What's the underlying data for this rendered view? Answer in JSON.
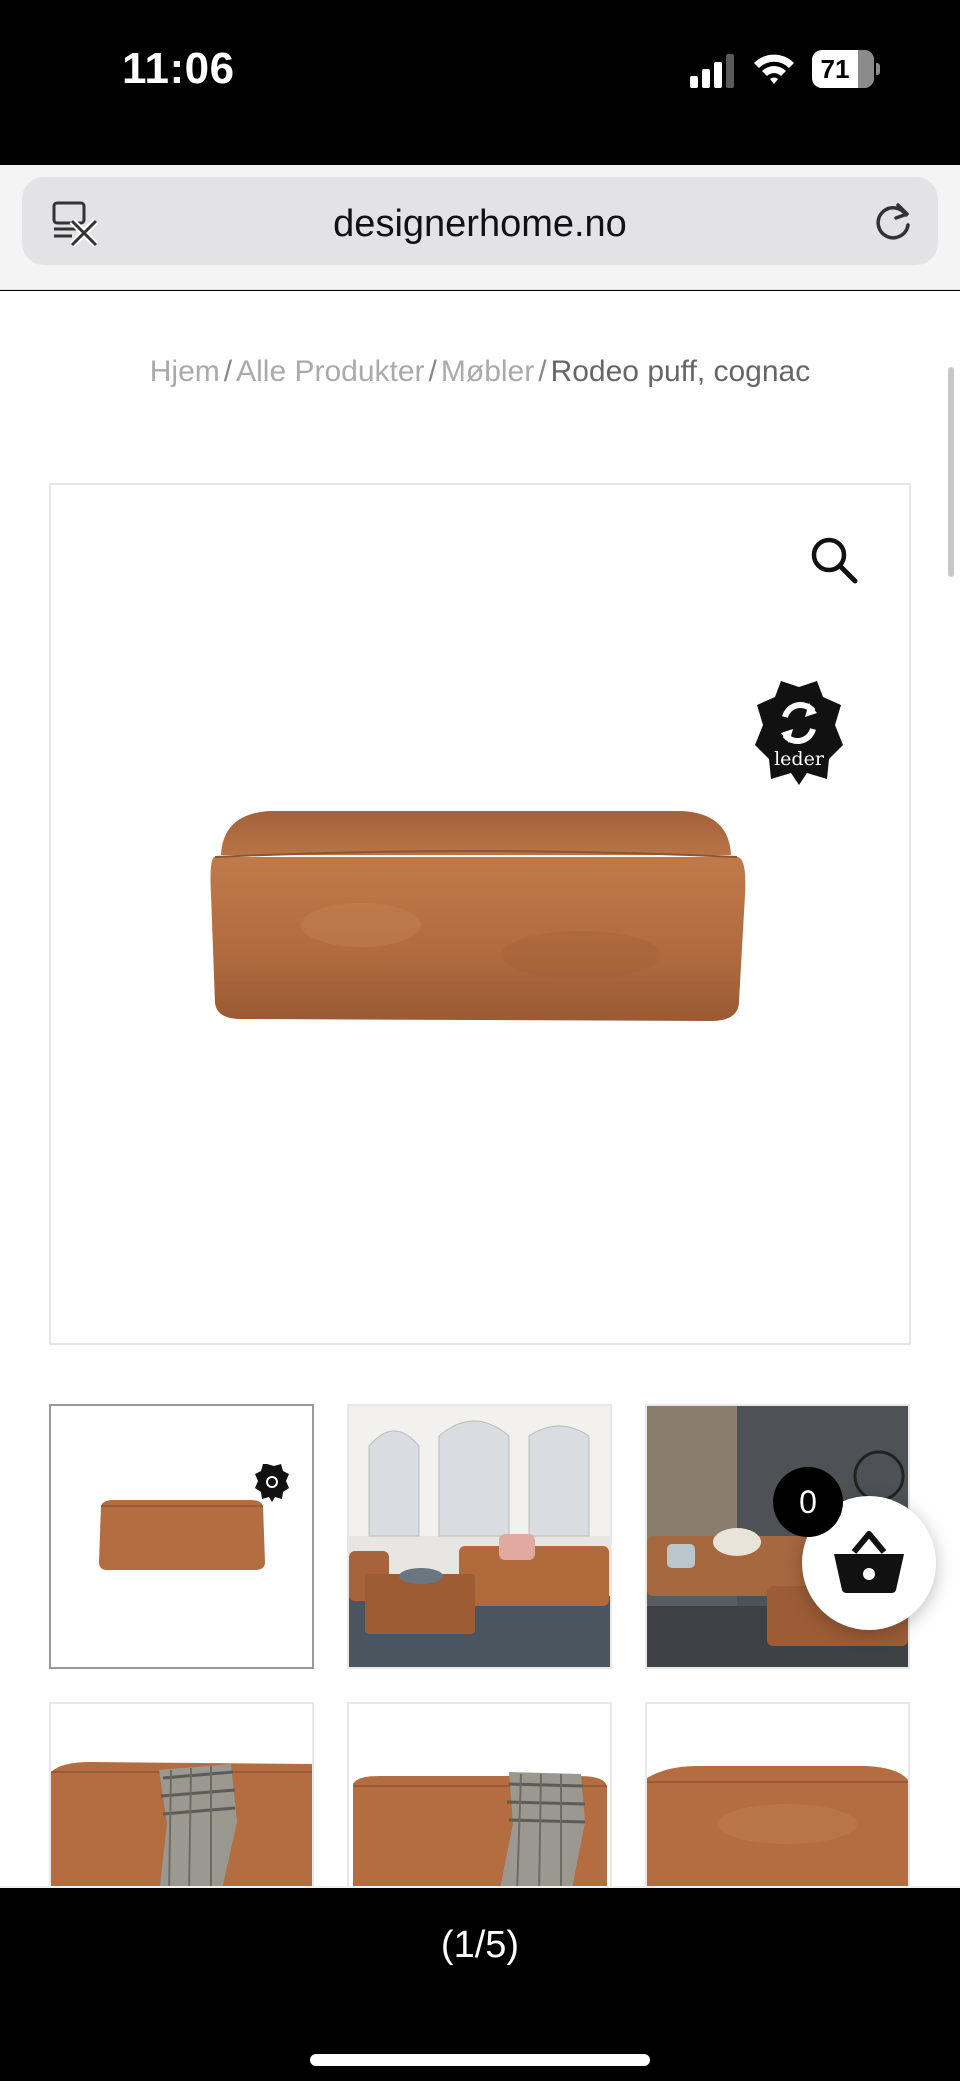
{
  "status": {
    "time": "11:06",
    "battery_level": "71"
  },
  "browser": {
    "url": "designerhome.no"
  },
  "breadcrumb": {
    "home": "Hjem",
    "all_products": "Alle Produkter",
    "furniture": "Møbler",
    "current": "Rodeo puff, cognac",
    "separator": "/"
  },
  "product_image": {
    "badge_text": "leder"
  },
  "thumbnails": [
    {
      "label": "pouf-white-background"
    },
    {
      "label": "living-room-scene-windows"
    },
    {
      "label": "living-room-scene-dark-wall"
    },
    {
      "label": "pouf-with-throw-side"
    },
    {
      "label": "pouf-with-throw-front"
    },
    {
      "label": "pouf-plain"
    }
  ],
  "cart": {
    "count": "0"
  },
  "gallery": {
    "counter": "(1/5)"
  },
  "colors": {
    "leather": "#b36b3e",
    "leather_dark": "#8e4f2b",
    "text_gray": "#aaaaaa"
  }
}
